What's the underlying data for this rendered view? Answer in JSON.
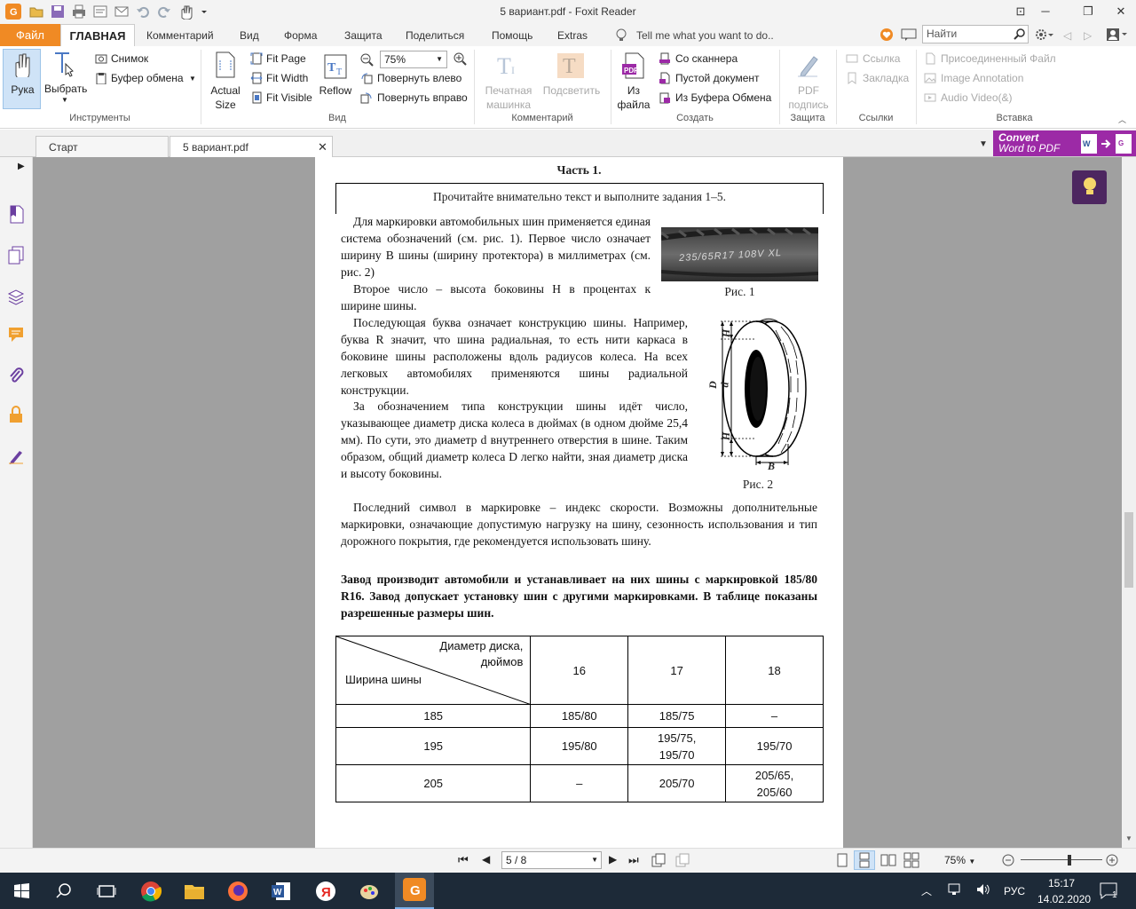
{
  "window": {
    "title": "5 вариант.pdf - Foxit Reader"
  },
  "menu": {
    "file": "Файл",
    "tabs": [
      "ГЛАВНАЯ",
      "Комментарий",
      "Вид",
      "Форма",
      "Защита",
      "Поделиться",
      "Помощь",
      "Extras"
    ],
    "tell_me": "Tell me what you want to do..",
    "search_placeholder": "Найти"
  },
  "ribbon": {
    "hand": "Рука",
    "select": "Выбрать",
    "snapshot": "Снимок",
    "clipboard": "Буфер обмена",
    "tools_group": "Инструменты",
    "actual_size_1": "Actual",
    "actual_size_2": "Size",
    "fit_page": "Fit Page",
    "fit_width": "Fit Width",
    "fit_visible": "Fit Visible",
    "reflow": "Reflow",
    "zoom_value": "75%",
    "rotate_left": "Повернуть влево",
    "rotate_right": "Повернуть вправо",
    "view_group": "Вид",
    "typewriter_1": "Печатная",
    "typewriter_2": "машинка",
    "highlight": "Подсветить",
    "comment_group": "Комментарий",
    "from_file_1": "Из",
    "from_file_2": "файла",
    "from_scanner": "Со сканнера",
    "blank_doc": "Пустой документ",
    "from_clipboard": "Из Буфера Обмена",
    "create_group": "Создать",
    "pdf_sign_1": "PDF",
    "pdf_sign_2": "подпись",
    "protect_group": "Защита",
    "link": "Ссылка",
    "bookmark": "Закладка",
    "links_group": "Ссылки",
    "attached_file": "Присоединенный Файл",
    "image_annotation": "Image Annotation",
    "audio_video": "Audio  Video(&)",
    "insert_group": "Вставка"
  },
  "doc_tabs": [
    {
      "label": "Старт"
    },
    {
      "label": "5 вариант.pdf"
    }
  ],
  "convert": {
    "line1": "Convert",
    "line2": "Word to PDF"
  },
  "document": {
    "heading": "Часть 1.",
    "instruction": "Прочитайте внимательно текст и выполните задания 1–5.",
    "p1": "Для маркировки автомобильных шин применяется единая система обозначений (см. рис. 1). Первое число означает ширину B шины (ширину протектора) в миллиметрах (см. рис. 2)",
    "p2": "Второе число – высота боковины H в процентах к ширине шины.",
    "p3": "Последующая буква означает конструкцию шины. Например, буква R значит, что шина радиальная, то есть нити каркаса в боковине шины расположены вдоль радиусов колеса. На всех легковых автомобилях применяются шины радиальной конструкции.",
    "p4": "За обозначением типа конструкции шины идёт число, указывающее диаметр диска колеса в дюймах (в одном дюйме 25,4 мм). По сути, это диаметр d внутреннего отверстия в шине. Таким образом, общий диаметр колеса D легко найти, зная диаметр диска и высоту боковины.",
    "p5": "Последний символ в маркировке – индекс скорости. Возможны дополнительные маркировки, означающие допустимую нагрузку на шину, сезонность использования и тип дорожного покрытия, где рекомендуется использовать шину.",
    "p6": "Завод производит автомобили и устанавливает на них шины с маркировкой 185/80 R16. Завод допускает установку шин с другими маркировками. В таблице показаны разрешенные размеры шин.",
    "fig1_caption": "Рис. 1",
    "fig1_tire_text": "235/65R17 108V XL",
    "fig2_caption": "Рис. 2",
    "fig2_labels": {
      "H": "H",
      "D": "D",
      "d": "d",
      "B": "B"
    },
    "table": {
      "corner_top": "Диаметр диска, дюймов",
      "corner_bottom": "Ширина шины",
      "cols": [
        "16",
        "17",
        "18"
      ],
      "rows": [
        {
          "width": "185",
          "cells": [
            "185/80",
            "185/75",
            "–"
          ]
        },
        {
          "width": "195",
          "cells": [
            "195/80",
            "195/75, 195/70",
            "195/70"
          ]
        },
        {
          "width": "205",
          "cells": [
            "–",
            "205/70",
            "205/65, 205/60"
          ]
        }
      ]
    }
  },
  "status": {
    "page": "5 / 8",
    "zoom": "75%",
    "zoom_level": 0.6
  },
  "taskbar": {
    "lang": "РУС",
    "time": "15:17",
    "date": "14.02.2020",
    "notif": "1"
  }
}
